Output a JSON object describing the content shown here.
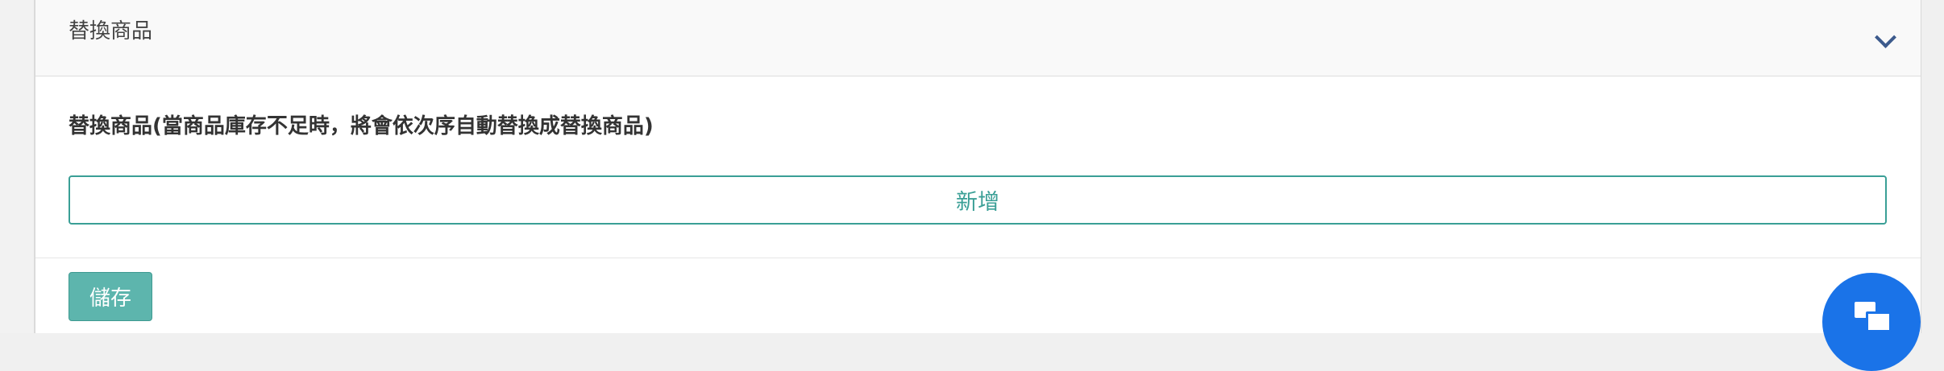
{
  "panel": {
    "title": "替換商品",
    "toggle_icon": "chevron-down-icon"
  },
  "section": {
    "label": "替換商品(當商品庫存不足時，將會依次序自動替換成替換商品)",
    "add_label": "新增"
  },
  "footer": {
    "save_label": "儲存"
  },
  "chat": {
    "icon": "chat-icon",
    "color": "#1a73e8"
  },
  "colors": {
    "accent": "#3a9f96",
    "save_bg": "#5db5ad",
    "chevron": "#3c5a8c"
  }
}
